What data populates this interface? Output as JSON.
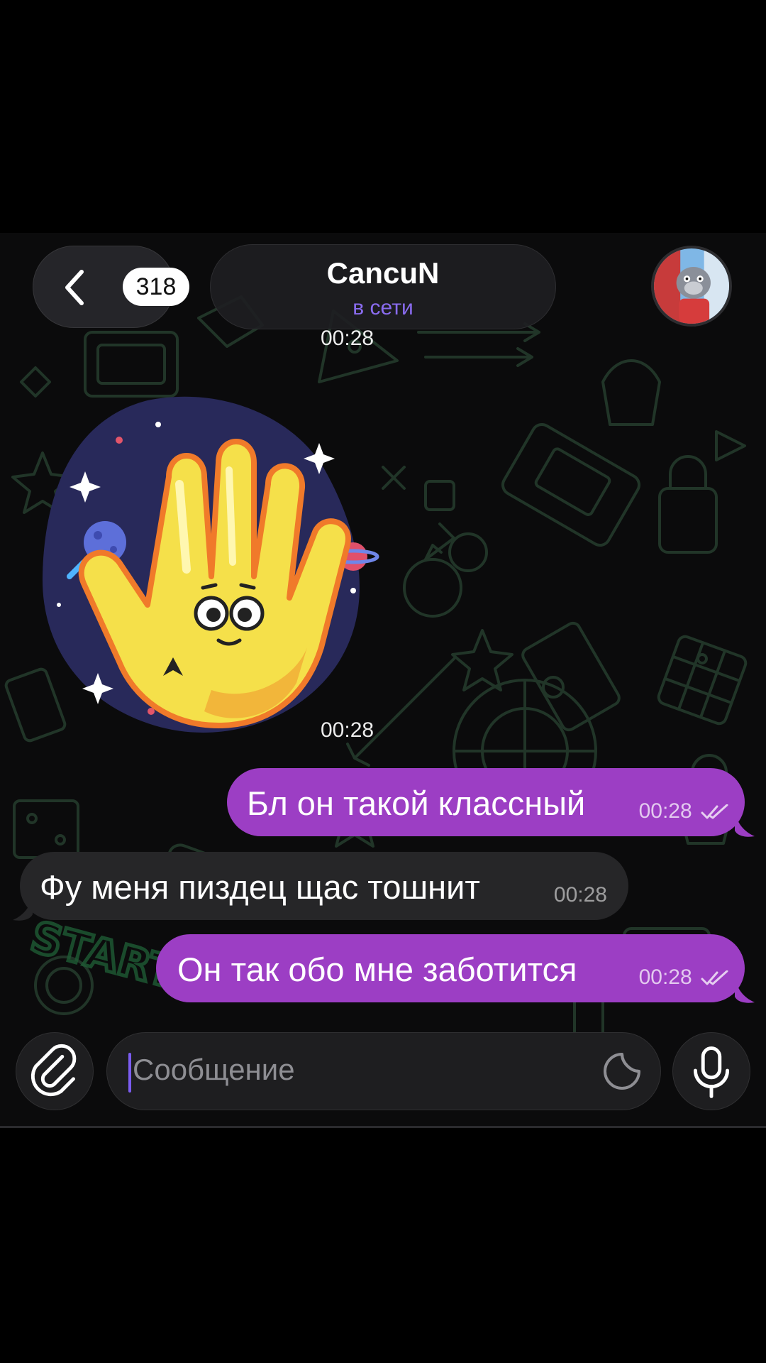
{
  "header": {
    "back_label": "<",
    "unread_count": "318",
    "chat_name": "CancuN",
    "status": "в сети"
  },
  "messages": [
    {
      "type": "time",
      "time": "00:28"
    },
    {
      "type": "sticker",
      "description": "waving-hand-sticker",
      "time": "00:28"
    },
    {
      "type": "outgoing",
      "text": "Бл он такой классный",
      "time": "00:28"
    },
    {
      "type": "incoming",
      "text": "Фу меня пиздец щас тошнит",
      "time": "00:28"
    },
    {
      "type": "outgoing",
      "text": "Он так обо мне заботится",
      "time": "00:28"
    }
  ],
  "composer": {
    "placeholder": "Сообщение"
  },
  "colors": {
    "outgoing_bubble": "#9c3ec4",
    "incoming_bubble": "#262628",
    "status_accent": "#8a6cf0",
    "background": "#0b0b0c"
  },
  "icons": [
    "chevron-left-icon",
    "attach-icon",
    "sticker-icon",
    "microphone-icon",
    "double-check-icon"
  ]
}
